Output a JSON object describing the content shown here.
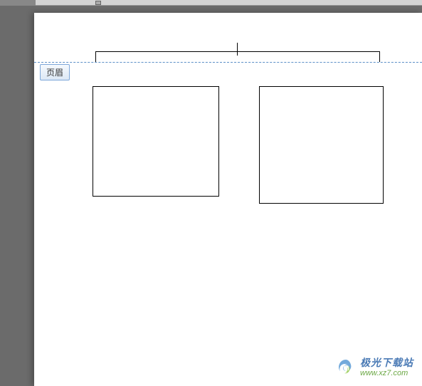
{
  "header": {
    "label": "页眉"
  },
  "watermark": {
    "title": "极光下载站",
    "url": "www.xz7.com"
  }
}
